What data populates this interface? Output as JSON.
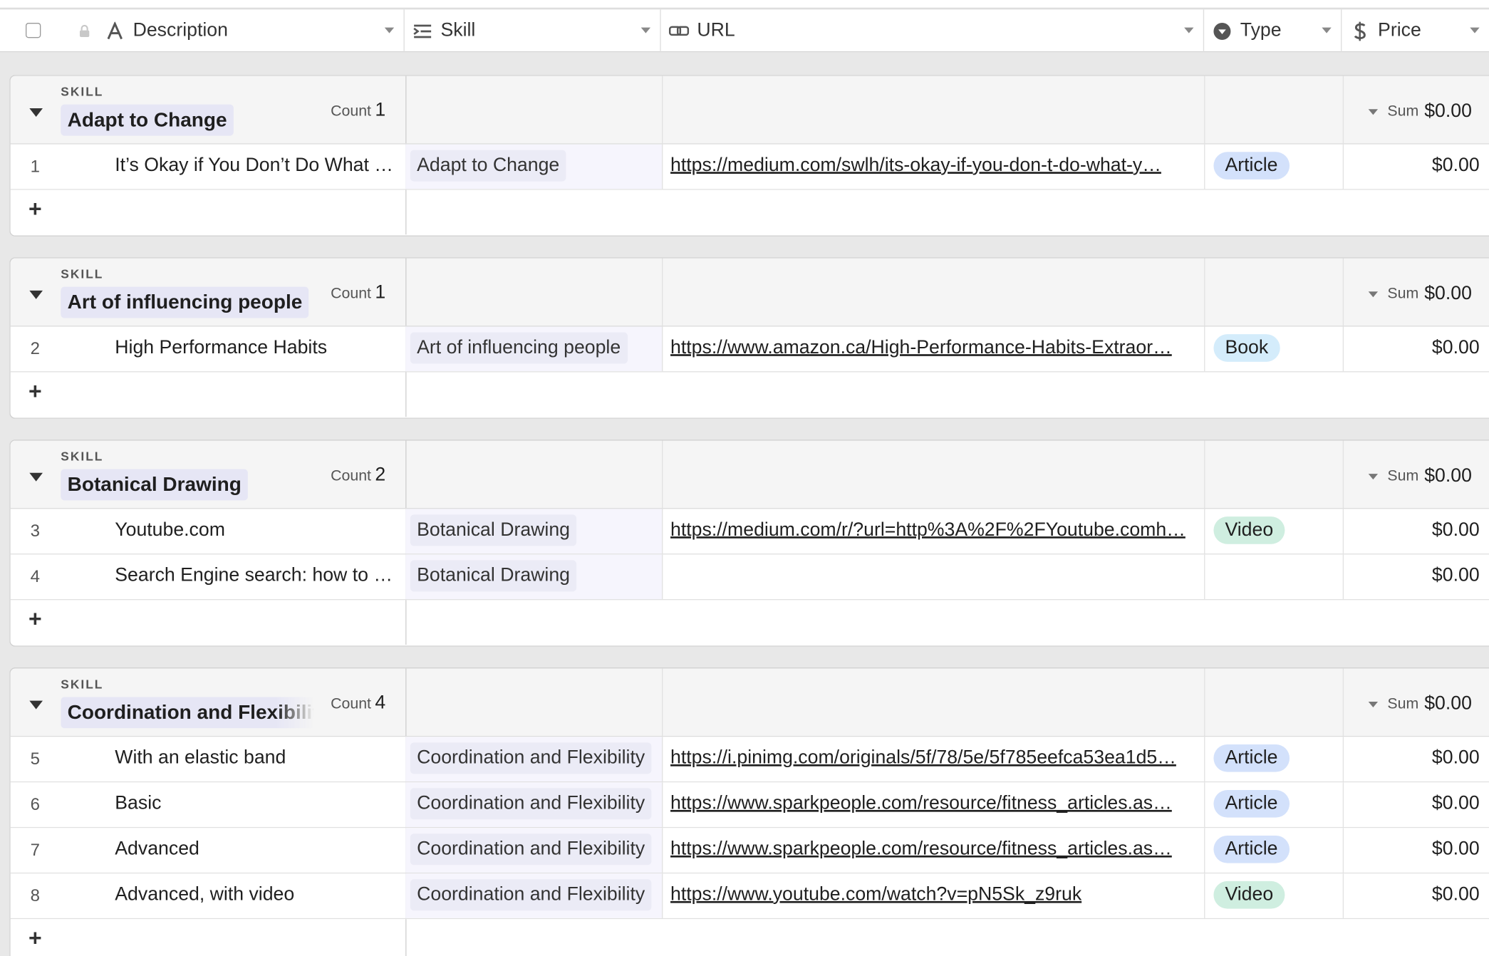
{
  "columns": {
    "description": "Description",
    "skill": "Skill",
    "url": "URL",
    "type": "Type",
    "price": "Price"
  },
  "group_tag": "SKILL",
  "count_label": "Count",
  "sum_label": "Sum",
  "groups": [
    {
      "name": "Adapt to Change",
      "count": "1",
      "sum": "$0.00",
      "rows": [
        {
          "num": "1",
          "description": "It’s Okay if You Don’t Do What …",
          "skill": "Adapt to Change",
          "url": "https://medium.com/swlh/its-okay-if-you-don-t-do-what-y…",
          "type": "Article",
          "price": "$0.00"
        }
      ]
    },
    {
      "name": "Art of influencing people",
      "count": "1",
      "sum": "$0.00",
      "rows": [
        {
          "num": "2",
          "description": "High Performance Habits",
          "skill": "Art of influencing people",
          "url": "https://www.amazon.ca/High-Performance-Habits-Extraor…",
          "type": "Book",
          "price": "$0.00"
        }
      ]
    },
    {
      "name": "Botanical Drawing",
      "count": "2",
      "sum": "$0.00",
      "rows": [
        {
          "num": "3",
          "description": "Youtube.com",
          "skill": "Botanical Drawing",
          "url": "https://medium.com/r/?url=http%3A%2F%2FYoutube.comh…",
          "type": "Video",
          "price": "$0.00"
        },
        {
          "num": "4",
          "description": "Search Engine search: how to …",
          "skill": "Botanical Drawing",
          "url": "",
          "type": "",
          "price": "$0.00"
        }
      ]
    },
    {
      "name": "Coordination and Flexibility",
      "count": "4",
      "sum": "$0.00",
      "rows": [
        {
          "num": "5",
          "description": "With an elastic band",
          "skill": "Coordination and Flexibility",
          "url": "https://i.pinimg.com/originals/5f/78/5e/5f785eefca53ea1d5…",
          "type": "Article",
          "price": "$0.00"
        },
        {
          "num": "6",
          "description": "Basic",
          "skill": "Coordination and Flexibility",
          "url": "https://www.sparkpeople.com/resource/fitness_articles.as…",
          "type": "Article",
          "price": "$0.00"
        },
        {
          "num": "7",
          "description": "Advanced",
          "skill": "Coordination and Flexibility",
          "url": "https://www.sparkpeople.com/resource/fitness_articles.as…",
          "type": "Article",
          "price": "$0.00"
        },
        {
          "num": "8",
          "description": "Advanced, with video",
          "skill": "Coordination and Flexibility",
          "url": "https://www.youtube.com/watch?v=pN5Sk_z9ruk",
          "type": "Video",
          "price": "$0.00"
        }
      ]
    }
  ],
  "type_colors": {
    "Article": "#d3e1fb",
    "Book": "#d4ecfb",
    "Video": "#cfeee0"
  },
  "add_row_symbol": "+"
}
